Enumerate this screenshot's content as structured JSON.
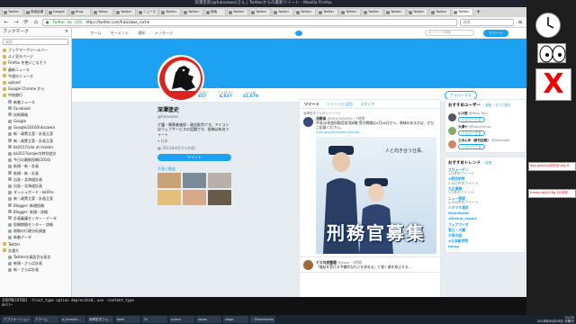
{
  "window_title": "深澤塗史(@fukazawa)さん | Twitterからの最新ツイート - Mozilla Firefox",
  "tabs": [
    "Twitter",
    "検索結果",
    "Google",
    "Bing",
    "Yahoo",
    "Twitter",
    "ニュース",
    "Twitter",
    "Twitter",
    "検索",
    "Twitter",
    "Twitter",
    "Twitter",
    "Twitter",
    "Twitter",
    "Twitter",
    "Twitter",
    "Twitter",
    "Twitter",
    "Twitter",
    "Twitter"
  ],
  "url": {
    "site": "Twitter, Inc. (US)",
    "address": "https://twitter.com/fukazawa_ruche"
  },
  "search_placeholder": "検索",
  "sidebar": {
    "title": "ブックマーク",
    "search_placeholder": "検索",
    "items": [
      "ブックマークツールバー",
      "よく見るページ",
      "Firefox を使いこなそう",
      "最新ニュース",
      "今週のニュース",
      "upload",
      "Google Chrome から",
      "中央銀行",
      "新着ニュース",
      "Facebook",
      "技術情報",
      "Google",
      "Google/2016/fukazawa",
      "新・政策立案・計画立案",
      "新・政策立案・計画立案",
      "bk2017/site at master",
      "bk2017/project/特別会計",
      "今日の最新投稿(2016)",
      "新規・新・計画",
      "新規・新・計画",
      "出発・北海道計画",
      "出発・北海道計画",
      "ダッシュボード・bk/Pro",
      "新・政策立案・計画立案",
      "Blogger: 新規投稿",
      "Blogger: 新規・詳細",
      "計画審議センター・データ",
      "投稿期間センター・詳細",
      "税制の行政分析調査",
      "新着データ",
      "Twitter",
      "交通大",
      "Twitterの真面目な発言",
      "新規・さらば計画",
      "新・さらば計画"
    ]
  },
  "twitter": {
    "nav": [
      "ホーム",
      "モーメント",
      "通知",
      "メッセージ"
    ],
    "search_placeholder": "キーワード検索",
    "tweet_button": "ツイート",
    "stats": [
      {
        "label": "ツイート",
        "value": "69,122"
      },
      {
        "label": "フォロー",
        "value": "457"
      },
      {
        "label": "フォロワー",
        "value": "4,937"
      },
      {
        "label": "いいね",
        "value": "31,879"
      }
    ],
    "follow_button": "フォローする",
    "profile": {
      "name": "深澤塗史",
      "handle": "@fukazawa",
      "bio": "介護・障害者施設・政治批判です。アイコンはウェブサービスの話題です。投稿は有名ツイート",
      "location": "日本",
      "joined": "2012年4月から利用",
      "tweet_button": "ツイート",
      "photos_label": "写真と動画"
    },
    "timeline_tabs": [
      "ツイート",
      "ツイートと返信",
      "メディア"
    ],
    "tweet1": {
      "retweet_note": "深澤塗史さんがリツイート",
      "author": "法務省",
      "handle": "@MOJ_HOUMU",
      "time": "・7時間",
      "text": "平成30年度刑務官採用試験 受付期間は4月26日から。興味のある方は、ぜひご応募ください。",
      "link": "moj.go.jp/kyousei1/kyous..."
    },
    "poster": {
      "caption": "人と向き合う仕事。",
      "title": "刑務官募集",
      "sub": "法務省"
    },
    "tweet2": {
      "author": "ナスの皮整理",
      "handle": "@nasu",
      "time": "・5時間",
      "text": "「福祉を受ける予備的な行いを求める」と書く者を抑止する..."
    },
    "suggest_title": "おすすめユーザー",
    "suggest_links": "・更新・すべて表示",
    "suggestions": [
      {
        "name": "小川宏",
        "handle": "@Takis-Toru",
        "follow": "フォローする"
      },
      {
        "name": "大澤十",
        "handle": "@Suto-Fumio",
        "follow": "フォローする"
      },
      {
        "name": "三木ん中（新日記版）",
        "handle": "@mikinaka",
        "follow": "フォローする"
      }
    ],
    "trends_title": "おすすめトレンド",
    "trends_link": "・変更",
    "trends": [
      {
        "name": "スウォーチン",
        "count": "1万件のツイート"
      },
      {
        "name": "#関西学院",
        "count": "3,541件のツイート"
      },
      {
        "name": "大正事務",
        "count": "1万件のツイート"
      },
      {
        "name": "ニュー関東",
        "count": "1,520件のツイート"
      },
      {
        "name": "シオマネ漁民",
        "count": ""
      },
      {
        "name": "Hashimoto",
        "count": ""
      },
      {
        "name": "#Nishio_report",
        "count": ""
      },
      {
        "name": "フェアマイダ",
        "count": ""
      },
      {
        "name": "宮口・大輔",
        "count": ""
      },
      {
        "name": "大将の話",
        "count": ""
      },
      {
        "name": "#日本新学院",
        "count": ""
      },
      {
        "name": "Jeong",
        "count": ""
      }
    ]
  },
  "terminal": {
    "lines": [
      "[DEPRECATED] -trust_type option deprecated, use -content_type",
      "dell~"
    ]
  },
  "panel": {
    "tasks": [
      "アプリケーション",
      "アラーム",
      "a_Scratch...",
      "深澤塗史さん...",
      "bash",
      "Tk",
      "xclock",
      "xeyes",
      "xlogo",
      "~/Downloads"
    ],
    "time": "21:02",
    "date": "2018年04月18日 月曜日"
  },
  "widgets": {
    "notes": [
      "dep-add-my@@@.org.rf",
      "tmsay-ap2018p 2018年"
    ]
  }
}
